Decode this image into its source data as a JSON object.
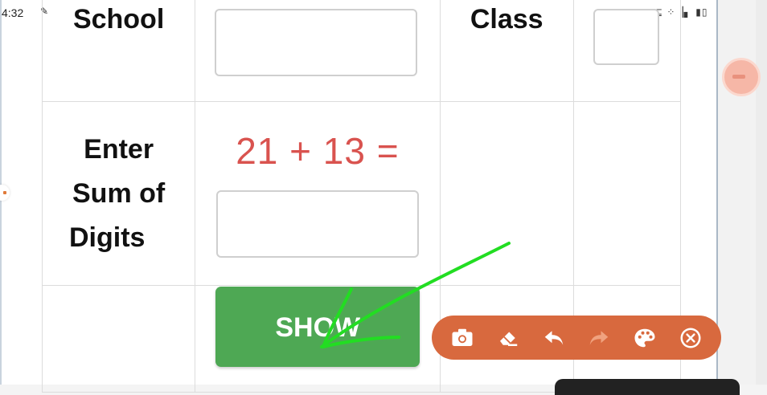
{
  "status_bar": {
    "time": "4:32",
    "indicators": "⊑ ⁘▕▖ ▮▯"
  },
  "form": {
    "school_label": "School",
    "class_label": "Class",
    "sum_label_line1": "Enter",
    "sum_label_line2": "Sum of",
    "sum_label_line3": "Digits",
    "captcha": "21 + 13 =",
    "school_value": "",
    "class_value": "",
    "sum_value": "",
    "show_label": "SHOW"
  },
  "toolbar": {
    "tools": [
      "camera-icon",
      "eraser-icon",
      "undo-icon",
      "redo-icon",
      "palette-icon",
      "close-icon"
    ]
  },
  "colors": {
    "captcha": "#d9534f",
    "show_button": "#4ea854",
    "toolbar": "#d8693e",
    "annotation_stroke": "#22dd22"
  }
}
